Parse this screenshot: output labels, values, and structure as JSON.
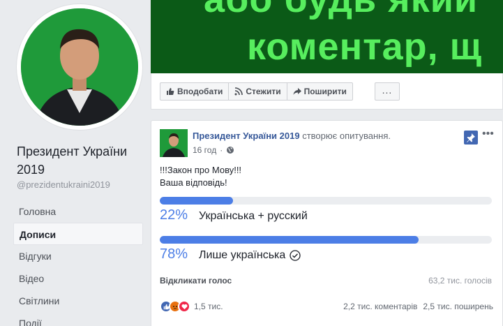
{
  "page": {
    "name": "Президент України 2019",
    "handle": "@prezidentukraini2019"
  },
  "nav": [
    "Головна",
    "Дописи",
    "Відгуки",
    "Відео",
    "Світлини",
    "Події"
  ],
  "banner": {
    "line1": "або будь який",
    "line2": "коментар, щ"
  },
  "actions": {
    "like": "Вподобати",
    "follow": "Стежити",
    "share": "Поширити",
    "more": "..."
  },
  "post": {
    "author": "Президент України 2019",
    "action": " створює опитування.",
    "time": "16 год",
    "text_line1": "!!!Закон про Мову!!!",
    "text_line2": "Ваша відповідь!",
    "options": [
      {
        "percent": "22%",
        "label": "Українська + русский",
        "value": 22,
        "selected": false
      },
      {
        "percent": "78%",
        "label": "Лише українська",
        "value": 78,
        "selected": true
      }
    ],
    "revoke": "Відкликати голос",
    "votes": "63,2 тис. голосів",
    "reactions": "1,5 тис.",
    "comments": "2,2 тис. коментарів",
    "shares": "2,5 тис. поширень"
  },
  "colors": {
    "brand": "#4267b2",
    "link": "#365899",
    "poll_fill": "#4c7ee6",
    "banner_bg": "#0b5a17",
    "banner_text": "#57ee5e"
  }
}
